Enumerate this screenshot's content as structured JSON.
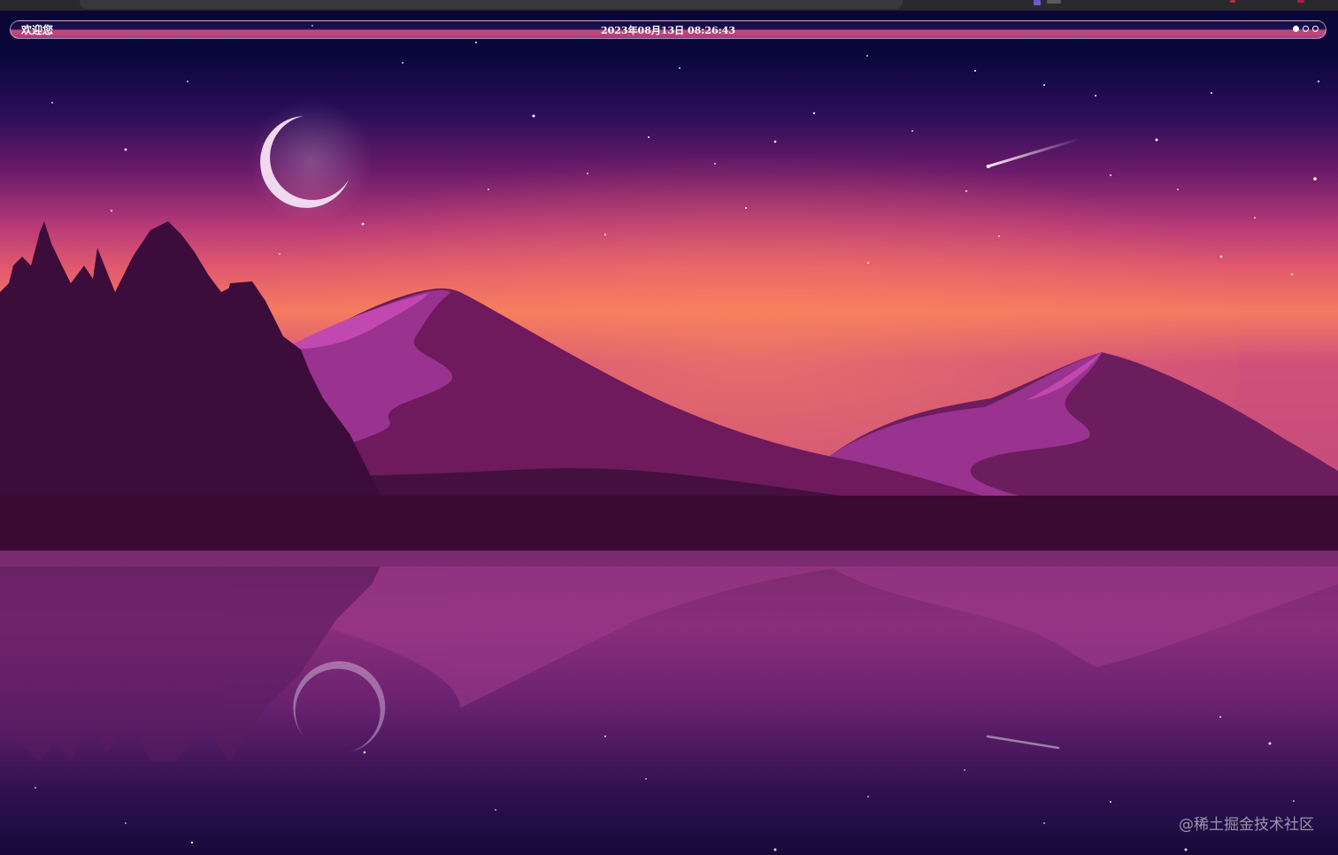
{
  "header": {
    "welcome_text": "欢迎您",
    "datetime": "2023年08月13日 08:26:43",
    "slides": [
      {
        "name": "slide-1",
        "active": true
      },
      {
        "name": "slide-2",
        "active": false
      },
      {
        "name": "slide-3",
        "active": false
      }
    ]
  },
  "wallpaper": {
    "scene": "night mountain lake with crescent moon, shooting star and pine trees",
    "colors": {
      "sky_top": "#0a0636",
      "sky_mid": "#4a1468",
      "horizon": "#f06a6a",
      "mountain": "#6e1a5c",
      "shore": "#3a0a34",
      "water": "#7a2a78"
    }
  },
  "watermark": {
    "text": "@稀土掘金技术社区"
  }
}
